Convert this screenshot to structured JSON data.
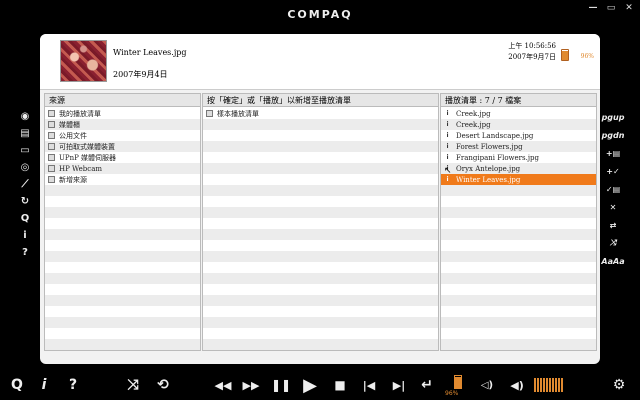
{
  "brand": "COMPAQ",
  "window_controls": {
    "minimize": "—",
    "restore": "▭",
    "close": "✕"
  },
  "header": {
    "title": "Winter Leaves.jpg",
    "date": "2007年9月4日",
    "clock": "上午 10:56:56",
    "today": "2007年9月7日",
    "battery_pct": "96%"
  },
  "columns": {
    "sources": {
      "header": "來源",
      "items": [
        "我的播放清單",
        "媒體櫃",
        "公用文件",
        "可拍取式媒體裝置",
        "UPnP 媒體伺服器",
        "HP Webcam",
        "新增來源"
      ]
    },
    "playlists": {
      "header": "按「確定」或「播放」以新增至播放清單",
      "items": [
        "樣本播放清單"
      ]
    },
    "queue": {
      "header": "播放清單 : 7 / 7 檔案",
      "items": [
        "Creek.jpg",
        "Creek.jpg",
        "Desert Landscape.jpg",
        "Forest Flowers.jpg",
        "Frangipani Flowers.jpg",
        "Oryx Antelope.jpg",
        "Winter Leaves.jpg"
      ],
      "selected_index": 6
    }
  },
  "left_toolbar": {
    "icons": [
      "disc-icon",
      "media-library-icon",
      "tv-icon",
      "gamepad-icon",
      "run-icon",
      "refresh-icon",
      "search-icon",
      "info-icon",
      "help-icon"
    ],
    "glyphs": [
      "◉",
      "▤",
      "▭",
      "◎",
      "⟋",
      "↻",
      "Q",
      "i",
      "?"
    ]
  },
  "right_toolbar": {
    "items": [
      "pgup",
      "pgdn",
      "+▤",
      "+✓",
      "✓▤",
      "✕",
      "⇄",
      "⤨",
      "AaAa"
    ]
  },
  "footer": {
    "search": "Q",
    "info": "i",
    "help": "?",
    "shuffle": "⤨",
    "repeat": "⟲",
    "rewind": "◀◀",
    "fast_forward": "▶▶",
    "pause": "❚❚",
    "play": "▶",
    "stop": "■",
    "prev": "|◀",
    "next": "▶|",
    "back": "↵",
    "battery_pct": "96%",
    "speaker_low": "◁)",
    "speaker": "◀)",
    "volume_level": 0.9,
    "settings": "⚙"
  }
}
